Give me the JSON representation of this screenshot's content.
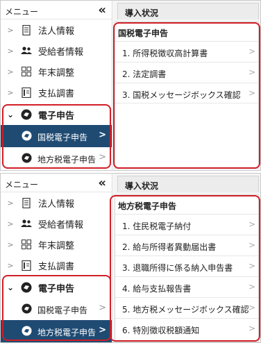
{
  "colors": {
    "highlight": "#d01e26",
    "active_bg": "#1f4b73"
  },
  "screens": [
    {
      "menu_title": "メニュー",
      "collapse_icon": "«",
      "sidebar_items": [
        {
          "label": "法人情報",
          "icon": "building-icon"
        },
        {
          "label": "受給者情報",
          "icon": "users-icon"
        },
        {
          "label": "年末調整",
          "icon": "grid-icon"
        },
        {
          "label": "支払調書",
          "icon": "document-icon"
        }
      ],
      "parent_label": "電子申告",
      "sub_items": [
        {
          "label": "国税電子申告",
          "active": true
        },
        {
          "label": "地方税電子申告",
          "active": false
        }
      ],
      "tab_title": "導入状況",
      "card_title": "国税電子申告",
      "card_items": [
        "1. 所得税徴収高計算書",
        "2. 法定調書",
        "3. 国税メッセージボックス確認"
      ]
    },
    {
      "menu_title": "メニュー",
      "collapse_icon": "«",
      "sidebar_items": [
        {
          "label": "法人情報",
          "icon": "building-icon"
        },
        {
          "label": "受給者情報",
          "icon": "users-icon"
        },
        {
          "label": "年末調整",
          "icon": "grid-icon"
        },
        {
          "label": "支払調書",
          "icon": "document-icon"
        }
      ],
      "parent_label": "電子申告",
      "sub_items": [
        {
          "label": "国税電子申告",
          "active": false
        },
        {
          "label": "地方税電子申告",
          "active": true
        }
      ],
      "tab_title": "導入状況",
      "card_title": "地方税電子申告",
      "card_items": [
        "1. 住民税電子納付",
        "2. 給与所得者異動届出書",
        "3. 退職所得に係る納入申告書",
        "4. 給与支払報告書",
        "5. 地方税メッセージボックス確認",
        "6. 特別徴収税額通知"
      ]
    }
  ]
}
